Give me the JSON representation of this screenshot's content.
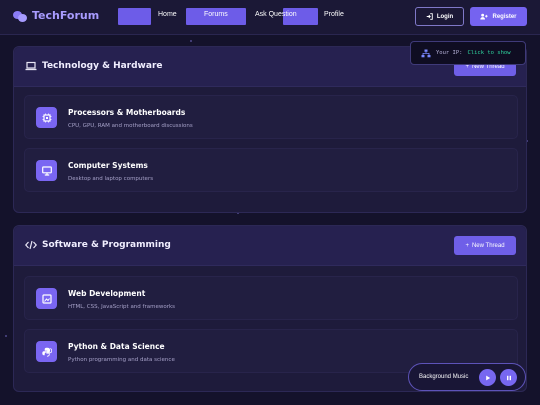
{
  "brand": {
    "name": "TechForum",
    "icon": "chat-bubbles-icon"
  },
  "nav": {
    "items": [
      {
        "label": "Home"
      },
      {
        "label": "Forums"
      },
      {
        "label": "Ask Question"
      },
      {
        "label": "Profile"
      }
    ]
  },
  "auth": {
    "login_label": "Login",
    "login_icon": "sign-in-icon",
    "register_label": "Register",
    "register_icon": "user-plus-icon"
  },
  "ip_tooltip": {
    "label": "Your IP:",
    "value": "Click to show",
    "icon": "network-icon"
  },
  "sections": [
    {
      "title": "Technology & Hardware",
      "icon": "laptop-icon",
      "new_thread_label": "New Thread",
      "forums": [
        {
          "title": "Processors & Motherboards",
          "description": "CPU, GPU, RAM and motherboard discussions",
          "icon": "microchip-icon"
        },
        {
          "title": "Computer Systems",
          "description": "Desktop and laptop computers",
          "icon": "desktop-icon"
        }
      ]
    },
    {
      "title": "Software & Programming",
      "icon": "code-icon",
      "new_thread_label": "New Thread",
      "forums": [
        {
          "title": "Web Development",
          "description": "HTML, CSS, JavaScript and frameworks",
          "icon": "window-icon"
        },
        {
          "title": "Python & Data Science",
          "description": "Python programming and data science",
          "icon": "python-icon"
        }
      ]
    }
  ],
  "music_player": {
    "label": "Background Music",
    "play_icon": "play-icon",
    "pause_icon": "pause-icon"
  },
  "colors": {
    "accent": "#7563f0",
    "background": "#14122b",
    "panel": "#1e1b3b",
    "ip_value": "#2fd6a0"
  }
}
